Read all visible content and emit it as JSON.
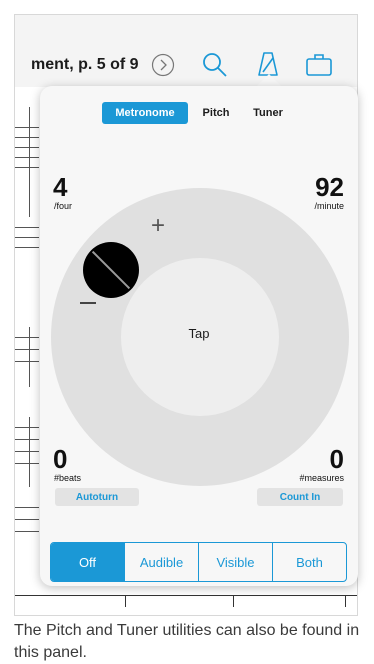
{
  "toolbar": {
    "document_title": "ment, p. 5 of 9",
    "icons": [
      "chevron-right-circle-icon",
      "search-icon",
      "metronome-icon",
      "briefcase-icon"
    ]
  },
  "popover": {
    "tabs": [
      {
        "label": "Metronome",
        "active": true
      },
      {
        "label": "Pitch",
        "active": false
      },
      {
        "label": "Tuner",
        "active": false
      }
    ],
    "time_signature": {
      "value": "4",
      "label": "/four"
    },
    "tempo": {
      "value": "92",
      "label": "/minute"
    },
    "beats": {
      "value": "0",
      "label": "#beats"
    },
    "measures": {
      "value": "0",
      "label": "#measures"
    },
    "dial": {
      "tap_label": "Tap",
      "plus": "+"
    },
    "autoturn_label": "Autoturn",
    "count_in_label": "Count In",
    "modes": [
      {
        "label": "Off",
        "active": true
      },
      {
        "label": "Audible",
        "active": false
      },
      {
        "label": "Visible",
        "active": false
      },
      {
        "label": "Both",
        "active": false
      }
    ]
  },
  "caption": "The Pitch and Tuner utilities can also be found in this panel.",
  "colors": {
    "accent": "#1b98d6",
    "dial_outer": "#e0e0e0",
    "dial_inner": "#eeeeee",
    "knob": "#000000"
  }
}
